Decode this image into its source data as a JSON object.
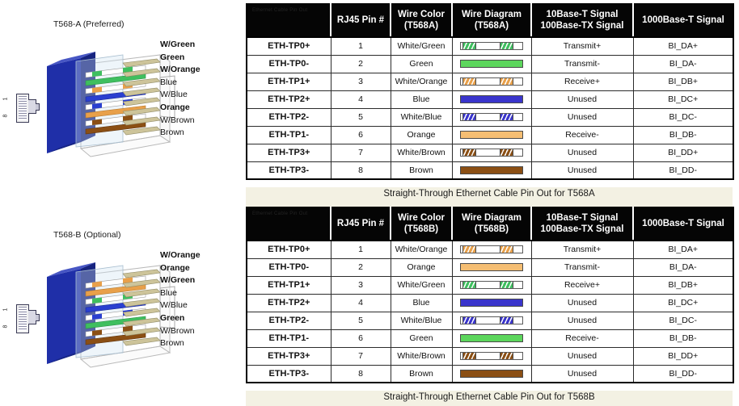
{
  "diagrams": [
    {
      "id": "t568a",
      "title": "T568-A (Preferred)",
      "jack_pin_top": "1",
      "jack_pin_bottom": "8",
      "wires": [
        {
          "label": "W/Green",
          "bold": true,
          "color": "#ffffff",
          "stripe": "#3fbf5f"
        },
        {
          "label": "Green",
          "bold": true,
          "color": "#3fbf5f",
          "stripe": ""
        },
        {
          "label": "W/Orange",
          "bold": true,
          "color": "#ffffff",
          "stripe": "#e8a04a"
        },
        {
          "label": "Blue",
          "bold": false,
          "color": "#2a3fd0",
          "stripe": ""
        },
        {
          "label": "W/Blue",
          "bold": false,
          "color": "#ffffff",
          "stripe": "#2a3fd0"
        },
        {
          "label": "Orange",
          "bold": true,
          "color": "#e8a04a",
          "stripe": ""
        },
        {
          "label": "W/Brown",
          "bold": false,
          "color": "#ffffff",
          "stripe": "#8b4f14"
        },
        {
          "label": "Brown",
          "bold": false,
          "color": "#8b4f14",
          "stripe": ""
        }
      ]
    },
    {
      "id": "t568b",
      "title": "T568-B (Optional)",
      "jack_pin_top": "1",
      "jack_pin_bottom": "8",
      "wires": [
        {
          "label": "W/Orange",
          "bold": true,
          "color": "#ffffff",
          "stripe": "#e8a04a"
        },
        {
          "label": "Orange",
          "bold": true,
          "color": "#e8a04a",
          "stripe": ""
        },
        {
          "label": "W/Green",
          "bold": true,
          "color": "#ffffff",
          "stripe": "#3fbf5f"
        },
        {
          "label": "Blue",
          "bold": false,
          "color": "#2a3fd0",
          "stripe": ""
        },
        {
          "label": "W/Blue",
          "bold": false,
          "color": "#ffffff",
          "stripe": "#2a3fd0"
        },
        {
          "label": "Green",
          "bold": true,
          "color": "#3fbf5f",
          "stripe": ""
        },
        {
          "label": "W/Brown",
          "bold": false,
          "color": "#ffffff",
          "stripe": "#8b4f14"
        },
        {
          "label": "Brown",
          "bold": false,
          "color": "#8b4f14",
          "stripe": ""
        }
      ]
    }
  ],
  "tables": [
    {
      "id": "table-t568a",
      "ghost_text": "Ethernet Cable Pin Out",
      "headers": [
        "",
        "RJ45 Pin #",
        "Wire Color\n(T568A)",
        "Wire Diagram\n(T568A)",
        "10Base-T Signal\n100Base-TX Signal",
        "1000Base-T Signal"
      ],
      "headers_lines": [
        [
          "",
          ""
        ],
        [
          "RJ45 Pin #",
          ""
        ],
        [
          "Wire Color",
          "(T568A)"
        ],
        [
          "Wire Diagram",
          "(T568A)"
        ],
        [
          "10Base-T Signal",
          "100Base-TX Signal"
        ],
        [
          "1000Base-T Signal",
          ""
        ]
      ],
      "caption": "Straight-Through Ethernet Cable Pin Out for T568A",
      "rows": [
        {
          "pair": "ETH-TP0+",
          "pin": "1",
          "wire_color": "White/Green",
          "wire_fill": "#ffffff",
          "wire_stripe": "#3fbf5f",
          "striped": true,
          "signal_10_100": "Transmit+",
          "signal_1000": "BI_DA+"
        },
        {
          "pair": "ETH-TP0-",
          "pin": "2",
          "wire_color": "Green",
          "wire_fill": "#5cd65c",
          "wire_stripe": "",
          "striped": false,
          "signal_10_100": "Transmit-",
          "signal_1000": "BI_DA-"
        },
        {
          "pair": "ETH-TP1+",
          "pin": "3",
          "wire_color": "White/Orange",
          "wire_fill": "#ffffff",
          "wire_stripe": "#e8a04a",
          "striped": true,
          "signal_10_100": "Receive+",
          "signal_1000": "BI_DB+"
        },
        {
          "pair": "ETH-TP2+",
          "pin": "4",
          "wire_color": "Blue",
          "wire_fill": "#3a35cc",
          "wire_stripe": "",
          "striped": false,
          "signal_10_100": "Unused",
          "signal_1000": "BI_DC+"
        },
        {
          "pair": "ETH-TP2-",
          "pin": "5",
          "wire_color": "White/Blue",
          "wire_fill": "#ffffff",
          "wire_stripe": "#3a35cc",
          "striped": true,
          "signal_10_100": "Unused",
          "signal_1000": "BI_DC-"
        },
        {
          "pair": "ETH-TP1-",
          "pin": "6",
          "wire_color": "Orange",
          "wire_fill": "#f5be73",
          "wire_stripe": "",
          "striped": false,
          "signal_10_100": "Receive-",
          "signal_1000": "BI_DB-"
        },
        {
          "pair": "ETH-TP3+",
          "pin": "7",
          "wire_color": "White/Brown",
          "wire_fill": "#ffffff",
          "wire_stripe": "#8b4f14",
          "striped": true,
          "signal_10_100": "Unused",
          "signal_1000": "BI_DD+"
        },
        {
          "pair": "ETH-TP3-",
          "pin": "8",
          "wire_color": "Brown",
          "wire_fill": "#8b4f14",
          "wire_stripe": "",
          "striped": false,
          "signal_10_100": "Unused",
          "signal_1000": "BI_DD-"
        }
      ]
    },
    {
      "id": "table-t568b",
      "ghost_text": "Ethernet Cable Pin Out",
      "headers_lines": [
        [
          "",
          ""
        ],
        [
          "RJ45 Pin #",
          ""
        ],
        [
          "Wire Color",
          "(T568B)"
        ],
        [
          "Wire Diagram",
          "(T568B)"
        ],
        [
          "10Base-T Signal",
          "100Base-TX Signal"
        ],
        [
          "1000Base-T Signal",
          ""
        ]
      ],
      "caption": "Straight-Through Ethernet Cable Pin Out for T568B",
      "rows": [
        {
          "pair": "ETH-TP0+",
          "pin": "1",
          "wire_color": "White/Orange",
          "wire_fill": "#ffffff",
          "wire_stripe": "#e8a04a",
          "striped": true,
          "signal_10_100": "Transmit+",
          "signal_1000": "BI_DA+"
        },
        {
          "pair": "ETH-TP0-",
          "pin": "2",
          "wire_color": "Orange",
          "wire_fill": "#f5be73",
          "wire_stripe": "",
          "striped": false,
          "signal_10_100": "Transmit-",
          "signal_1000": "BI_DA-"
        },
        {
          "pair": "ETH-TP1+",
          "pin": "3",
          "wire_color": "White/Green",
          "wire_fill": "#ffffff",
          "wire_stripe": "#3fbf5f",
          "striped": true,
          "signal_10_100": "Receive+",
          "signal_1000": "BI_DB+"
        },
        {
          "pair": "ETH-TP2+",
          "pin": "4",
          "wire_color": "Blue",
          "wire_fill": "#3a35cc",
          "wire_stripe": "",
          "striped": false,
          "signal_10_100": "Unused",
          "signal_1000": "BI_DC+"
        },
        {
          "pair": "ETH-TP2-",
          "pin": "5",
          "wire_color": "White/Blue",
          "wire_fill": "#ffffff",
          "wire_stripe": "#3a35cc",
          "striped": true,
          "signal_10_100": "Unused",
          "signal_1000": "BI_DC-"
        },
        {
          "pair": "ETH-TP1-",
          "pin": "6",
          "wire_color": "Green",
          "wire_fill": "#5cd65c",
          "wire_stripe": "",
          "striped": false,
          "signal_10_100": "Receive-",
          "signal_1000": "BI_DB-"
        },
        {
          "pair": "ETH-TP3+",
          "pin": "7",
          "wire_color": "White/Brown",
          "wire_fill": "#ffffff",
          "wire_stripe": "#8b4f14",
          "striped": true,
          "signal_10_100": "Unused",
          "signal_1000": "BI_DD+"
        },
        {
          "pair": "ETH-TP3-",
          "pin": "8",
          "wire_color": "Brown",
          "wire_fill": "#8b4f14",
          "wire_stripe": "",
          "striped": false,
          "signal_10_100": "Unused",
          "signal_1000": "BI_DD-"
        }
      ]
    }
  ],
  "colors": {
    "header_bg": "#050505",
    "caption_bg": "#f3f1e3",
    "connector_body": "#1f2fa8",
    "page_bg": "#ffffff"
  }
}
